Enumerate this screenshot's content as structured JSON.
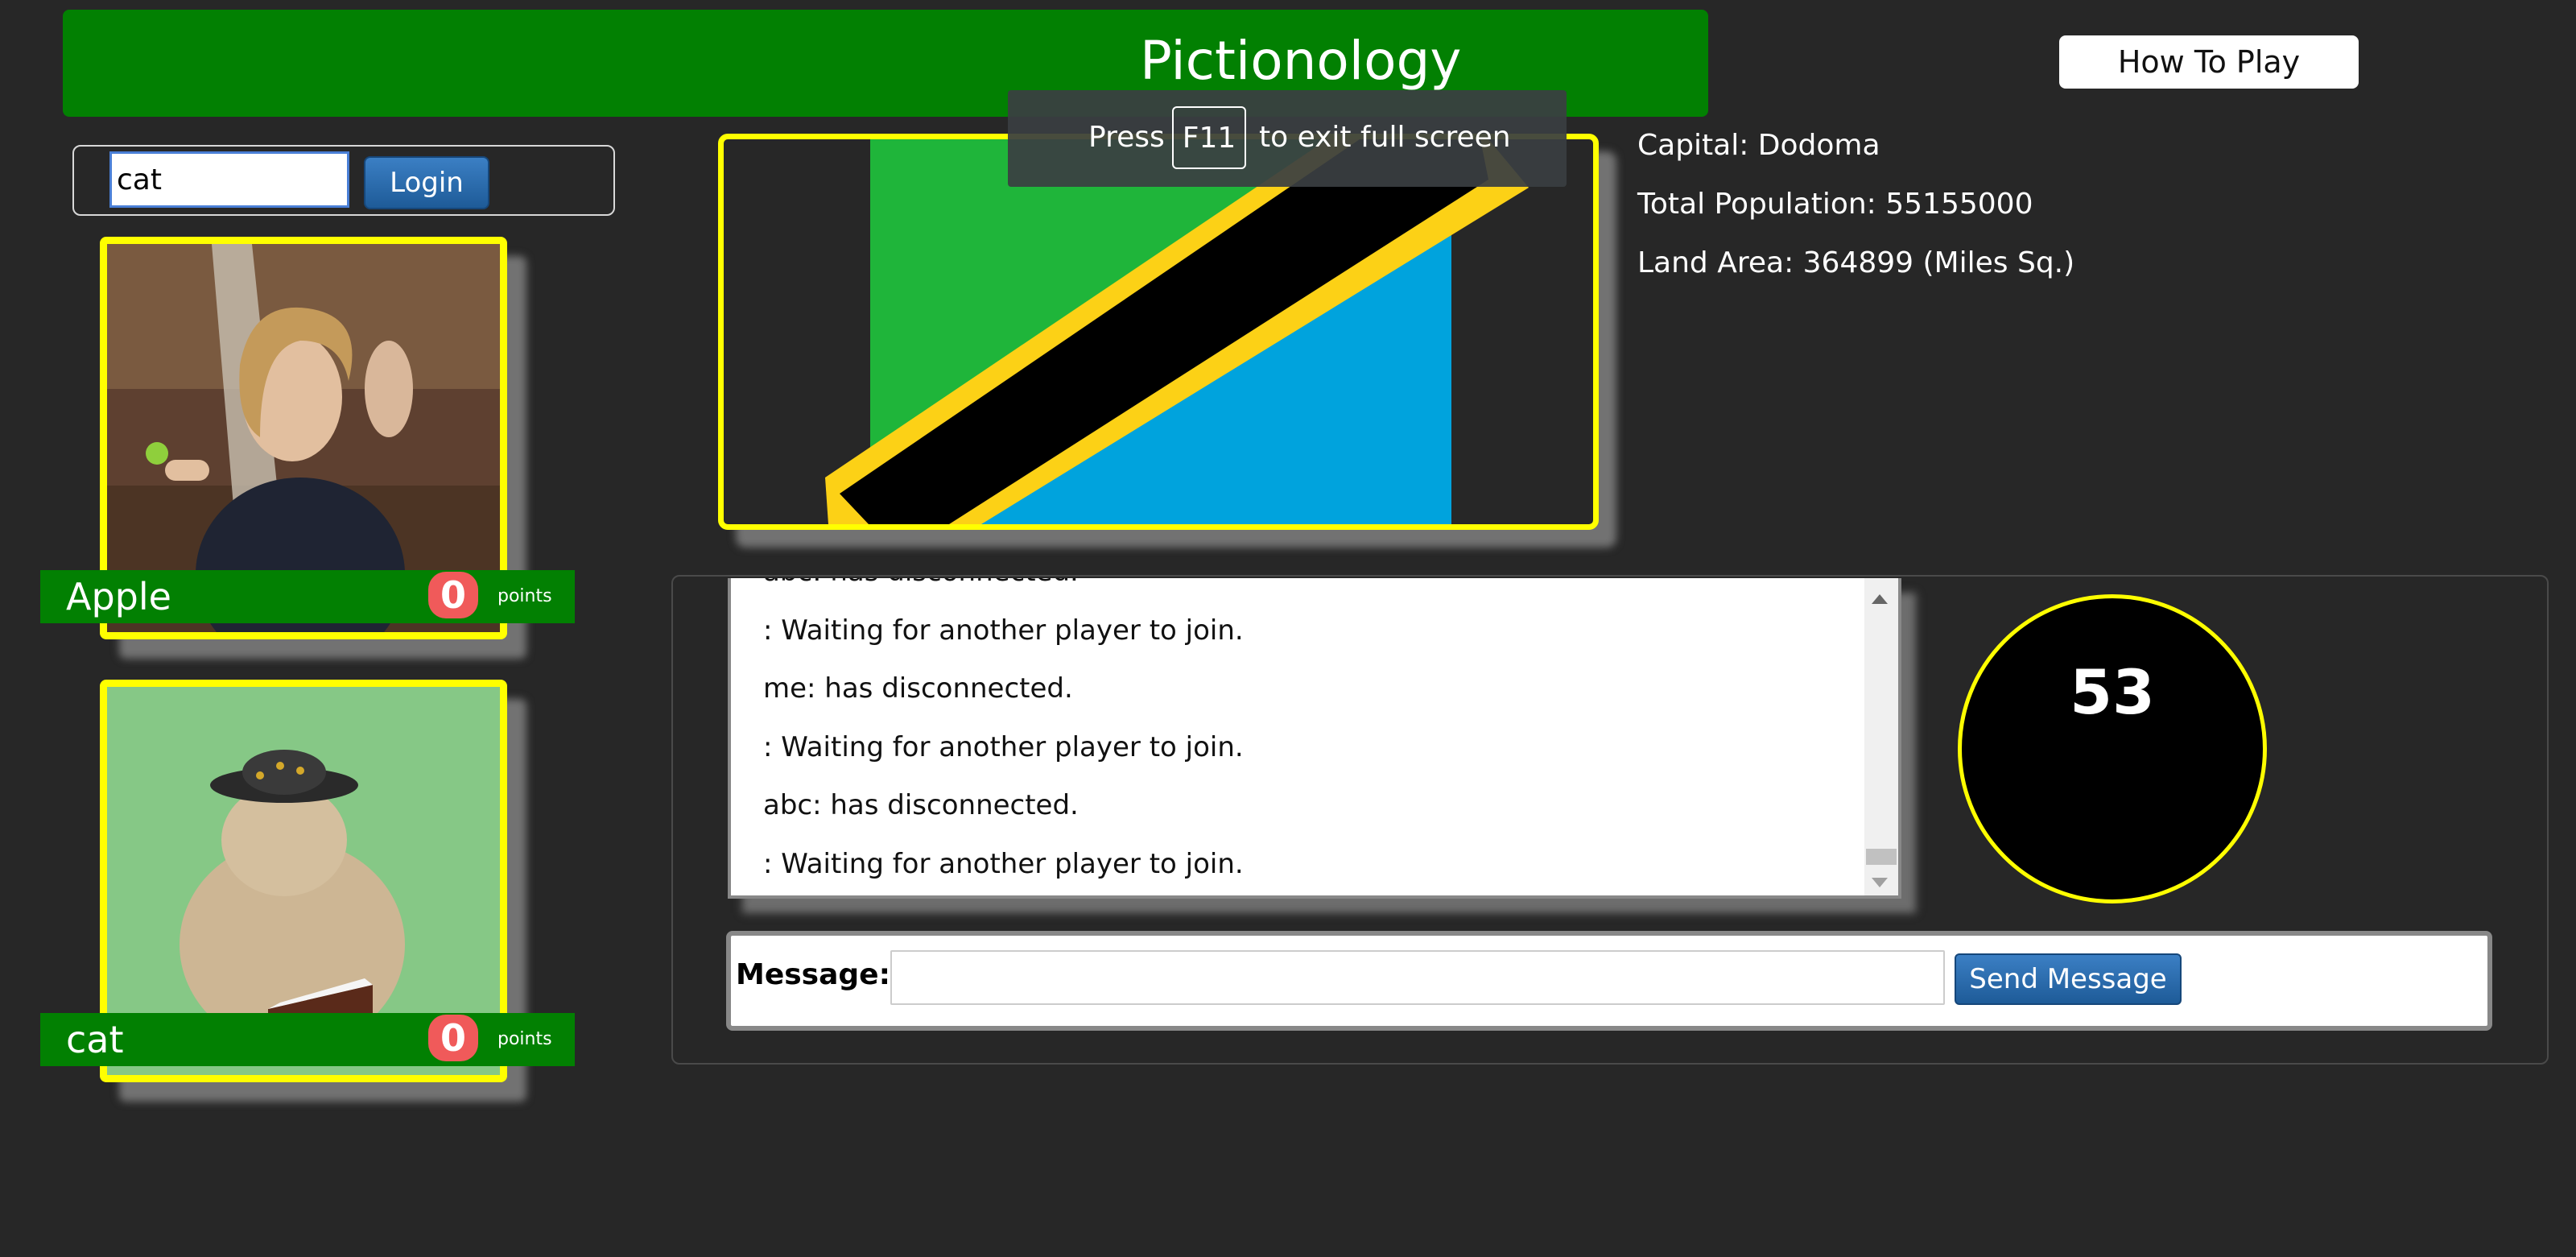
{
  "header": {
    "title": "Pictionology",
    "how_to_play_label": "How To Play"
  },
  "login": {
    "username_value": "cat",
    "login_label": "Login"
  },
  "players": [
    {
      "name": "Apple",
      "score": "0",
      "points_label": "points"
    },
    {
      "name": "cat",
      "score": "0",
      "points_label": "points"
    }
  ],
  "fullscreen_notice": {
    "press": "Press",
    "key": "F11",
    "rest": "to exit full screen"
  },
  "country_info": {
    "capital": "Capital: Dodoma",
    "population": "Total Population: 55155000",
    "land_area": "Land Area: 364899 (Miles Sq.)"
  },
  "flag_colors": {
    "green": "#1fb53a",
    "blue": "#00a3dd",
    "black": "#000000",
    "yellow": "#fcd116"
  },
  "chat": {
    "lines": [
      "abc: has disconnected.",
      ": Waiting for another player to join.",
      "me: has disconnected.",
      ": Waiting for another player to join.",
      "abc: has disconnected.",
      ": Waiting for another player to join."
    ]
  },
  "timer": {
    "value": "53"
  },
  "message": {
    "label": "Message:",
    "value": "",
    "send_label": "Send Message"
  }
}
